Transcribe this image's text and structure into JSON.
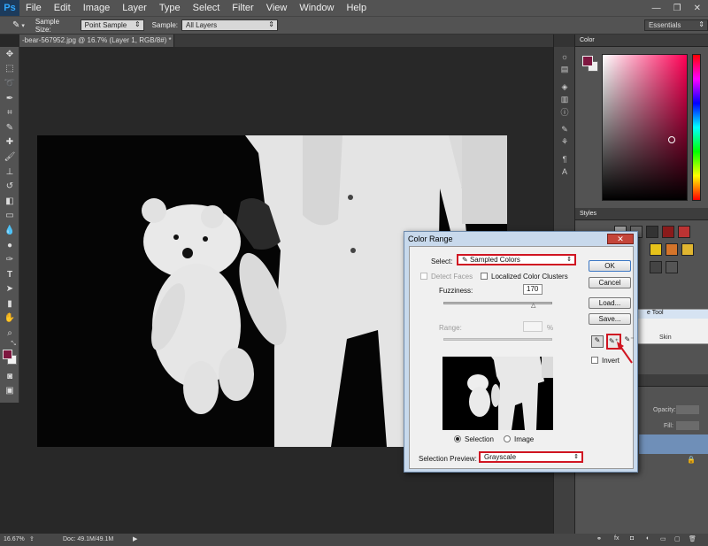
{
  "app": {
    "logo": "Ps"
  },
  "menu": [
    "File",
    "Edit",
    "Image",
    "Layer",
    "Type",
    "Select",
    "Filter",
    "View",
    "Window",
    "Help"
  ],
  "options_bar": {
    "sample_size_label": "Sample Size:",
    "sample_size_value": "Point Sample",
    "sample_label": "Sample:",
    "sample_value": "All Layers",
    "workspace": "Essentials"
  },
  "document_tab": "-bear-567952.jpg @ 16.7% (Layer 1, RGB/8#) *",
  "status_bar": {
    "zoom": "16.67%",
    "doc": "Doc: 49.1M/49.1M"
  },
  "panels": {
    "color_title": "Color",
    "styles_title": "Styles",
    "colors": {
      "foreground": "#7e1740",
      "hue_top": "#ff0055"
    }
  },
  "dialog": {
    "title": "Color Range",
    "select_label": "Select:",
    "select_value": "Sampled Colors",
    "detect_faces": "Detect Faces",
    "localized": "Localized Color Clusters",
    "fuzziness_label": "Fuzziness:",
    "fuzziness_value": "170",
    "range_label": "Range:",
    "range_unit": "%",
    "selection_radio": "Selection",
    "image_radio": "Image",
    "preview_label": "Selection Preview:",
    "preview_value": "Grayscale",
    "buttons": {
      "ok": "OK",
      "cancel": "Cancel",
      "load": "Load...",
      "save": "Save..."
    },
    "invert": "Invert"
  },
  "floating_panel": {
    "title": "e Tool",
    "skin": "Skin"
  },
  "layers_panel": {
    "opacity": "Opacity:",
    "fill": "Fill:"
  }
}
